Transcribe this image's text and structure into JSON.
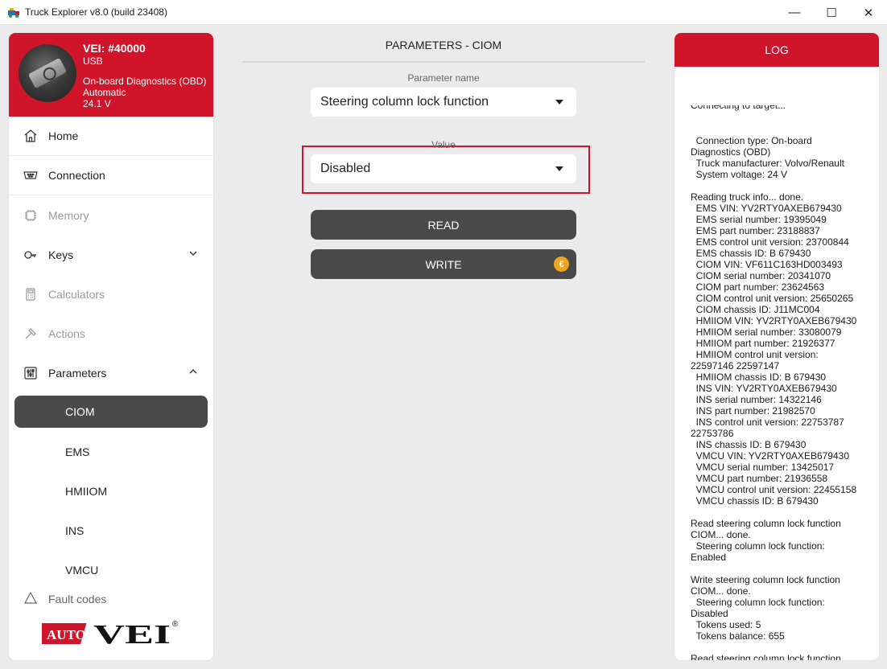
{
  "window": {
    "title": "Truck Explorer v8.0 (build 23408)",
    "minimize": "—",
    "maximize": "☐",
    "close": "✕"
  },
  "device": {
    "title": "VEI: #40000",
    "interface": "USB",
    "mode": "On-board Diagnostics (OBD)",
    "detection": "Automatic",
    "voltage": "24.1 V"
  },
  "nav": {
    "home": "Home",
    "connection": "Connection",
    "memory": "Memory",
    "keys": "Keys",
    "calculators": "Calculators",
    "actions": "Actions",
    "parameters": "Parameters",
    "sub": [
      "CIOM",
      "EMS",
      "HMIIOM",
      "INS",
      "VMCU"
    ],
    "fault_codes": "Fault codes"
  },
  "logo": {
    "auto": "AUTO",
    "vei": "VEI",
    "reg": "®"
  },
  "center": {
    "title": "PARAMETERS - CIOM",
    "param_label": "Parameter name",
    "param_value": "Steering column lock function",
    "value_label": "Value",
    "value_value": "Disabled",
    "read": "READ",
    "write": "WRITE",
    "coin": "€"
  },
  "log": {
    "title": "LOG",
    "first_line": "Connecting to target...",
    "text": "  Connection type: On-board Diagnostics (OBD)\n  Truck manufacturer: Volvo/Renault\n  System voltage: 24 V\n\nReading truck info... done.\n  EMS VIN: YV2RTY0AXEB679430\n  EMS serial number: 19395049\n  EMS part number: 23188837\n  EMS control unit version: 23700844\n  EMS chassis ID: B 679430\n  CIOM VIN: VF611C163HD003493\n  CIOM serial number: 20341070\n  CIOM part number: 23624563\n  CIOM control unit version: 25650265\n  CIOM chassis ID: J11MC004\n  HMIIOM VIN: YV2RTY0AXEB679430\n  HMIIOM serial number: 33080079\n  HMIIOM part number: 21926377\n  HMIIOM control unit version: 22597146 22597147\n  HMIIOM chassis ID: B 679430\n  INS VIN: YV2RTY0AXEB679430\n  INS serial number: 14322146\n  INS part number: 21982570\n  INS control unit version: 22753787 22753786\n  INS chassis ID: B 679430\n  VMCU VIN: YV2RTY0AXEB679430\n  VMCU serial number: 13425017\n  VMCU part number: 21936558\n  VMCU control unit version: 22455158\n  VMCU chassis ID: B 679430\n\nRead steering column lock function CIOM... done.\n  Steering column lock function: Enabled\n\nWrite steering column lock function CIOM... done.\n  Steering column lock function: Disabled\n  Tokens used: 5\n  Tokens balance: 655\n\nRead steering column lock function CIOM... done.\n  Steering column lock function: Disabled"
  },
  "colors": {
    "brand_red": "#d0152b",
    "button_dark": "#4a4a4a",
    "coin": "#f0a41b"
  }
}
